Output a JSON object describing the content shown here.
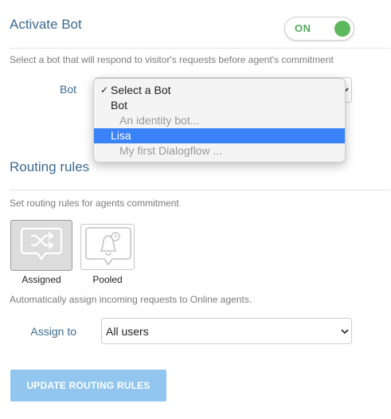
{
  "activate_bot": {
    "title": "Activate Bot",
    "toggle_state": "ON",
    "description": "Select a bot that will respond to visitor's requests before agent's commitment",
    "bot_label": "Bot",
    "bot_select": {
      "options": [
        {
          "label": "Select a Bot",
          "checked": true
        },
        {
          "label": "Bot",
          "kind": "group"
        },
        {
          "label": "An identity bot...",
          "kind": "disabled"
        },
        {
          "label": "Lisa",
          "kind": "highlighted"
        },
        {
          "label": "My first Dialogflow ...",
          "kind": "disabled"
        }
      ]
    }
  },
  "routing_rules": {
    "title": "Routing rules",
    "description": "Set routing rules for agents commitment",
    "modes": [
      {
        "label": "Assigned",
        "icon": "shuffle-chat-icon",
        "active": true
      },
      {
        "label": "Pooled",
        "icon": "bell-clock-chat-icon",
        "active": false
      }
    ],
    "mode_description": "Automatically assign incoming requests to Online agents.",
    "assign_to_label": "Assign to",
    "assign_to_value": "All users",
    "update_button": "UPDATE ROUTING RULES"
  },
  "colors": {
    "heading": "#3d6a8f",
    "toggle_on": "#5cb85c",
    "highlight": "#3a82f7",
    "button_disabled": "#93c6ef"
  }
}
